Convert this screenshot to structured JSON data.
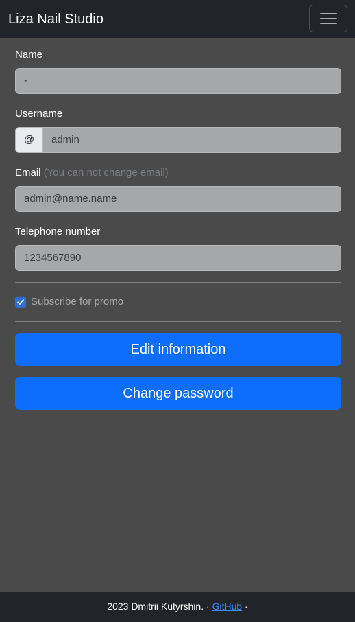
{
  "navbar": {
    "brand": "Liza Nail Studio",
    "toggler_icon": "hamburger-menu-icon"
  },
  "form": {
    "name": {
      "label": "Name",
      "value": "-"
    },
    "username": {
      "label": "Username",
      "prefix": "@",
      "value": "admin"
    },
    "email": {
      "label": "Email",
      "note": "(You can not change email)",
      "value": "admin@name.name"
    },
    "telephone": {
      "label": "Telephone number",
      "value": "1234567890"
    },
    "subscribe": {
      "label": "Subscribe for promo",
      "checked": true
    }
  },
  "buttons": {
    "edit": "Edit information",
    "change_password": "Change password"
  },
  "footer": {
    "text": "2023 Dmitrii Kutyrshin. · ",
    "link": "GitHub",
    "suffix": " ·"
  },
  "colors": {
    "primary": "#0d6efd",
    "navbar_bg": "#212529",
    "page_bg": "#4a4a4a"
  }
}
